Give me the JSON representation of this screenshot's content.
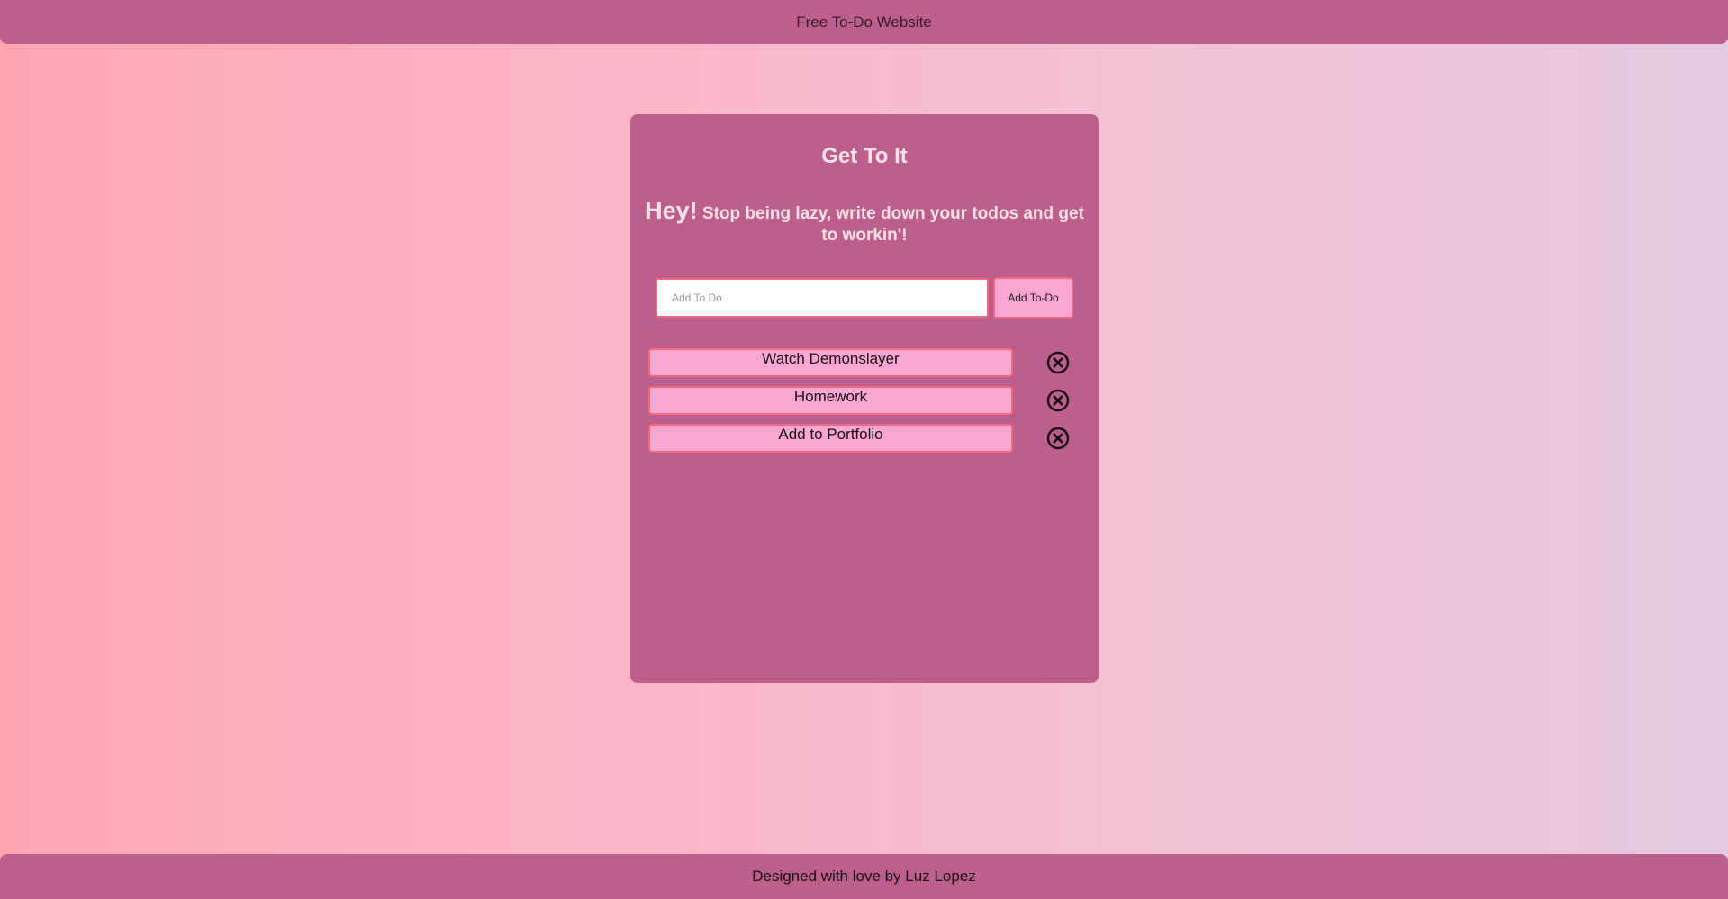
{
  "header": {
    "title": "Free To-Do Website"
  },
  "card": {
    "title": "Get To It",
    "tagline_hey": "Hey!",
    "tagline_rest": "Stop being lazy, write down your todos and get to workin'!",
    "input": {
      "placeholder": "Add To Do",
      "value": ""
    },
    "add_button_label": "Add To-Do",
    "todos": [
      {
        "label": "Watch Demonslayer"
      },
      {
        "label": "Homework"
      },
      {
        "label": "Add to Portfolio"
      }
    ]
  },
  "footer": {
    "text": "Designed with love by Luz Lopez"
  },
  "icons": {
    "delete": "close-circle-icon"
  },
  "colors": {
    "bar": "#bd5f8c",
    "card": "#bd5f8c",
    "item_fill": "#f8a7d2",
    "item_border": "#ef6b7c",
    "title_text": "#fde1e8"
  }
}
